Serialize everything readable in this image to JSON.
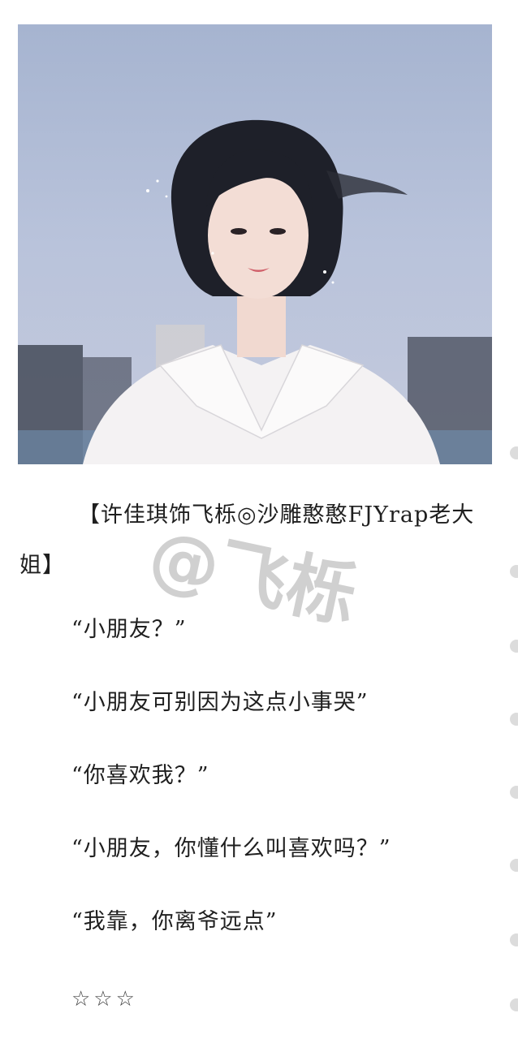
{
  "post": {
    "title": "【许佳琪饰飞栎◎沙雕憨憨FJYrap老大姐】",
    "lines": [
      "“小朋友？”",
      "“小朋友可别因为这点小事哭”",
      "“你喜欢我？”",
      "“小朋友，你懂什么叫喜欢吗？”",
      "“我靠，你离爷远点”"
    ],
    "stars": "☆☆☆",
    "watermark": "@飞栎"
  },
  "colors": {
    "sky": "#b3bfd8",
    "text": "#1f1f1f",
    "watermark": "#969696"
  }
}
